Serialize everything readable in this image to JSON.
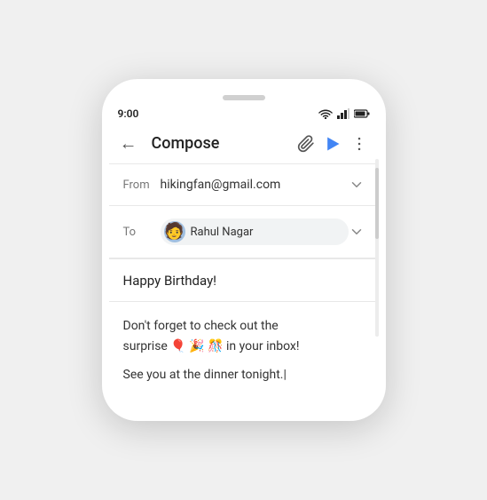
{
  "phone": {
    "time": "9:00"
  },
  "toolbar": {
    "title": "Compose",
    "back_icon": "←",
    "attach_icon": "🔗",
    "more_icon": "⋮"
  },
  "from_field": {
    "label": "From",
    "value": "hikingfan@gmail.com"
  },
  "to_field": {
    "label": "To",
    "recipient_name": "Rahul Nagar",
    "avatar_emoji": "👤"
  },
  "subject": {
    "text": "Happy Birthday!"
  },
  "body": {
    "line1": "Don't forget to check out the",
    "line2_part1": "surprise 🎈 🎉 🎊 in your inbox!",
    "line3": "See you at the dinner tonight."
  }
}
